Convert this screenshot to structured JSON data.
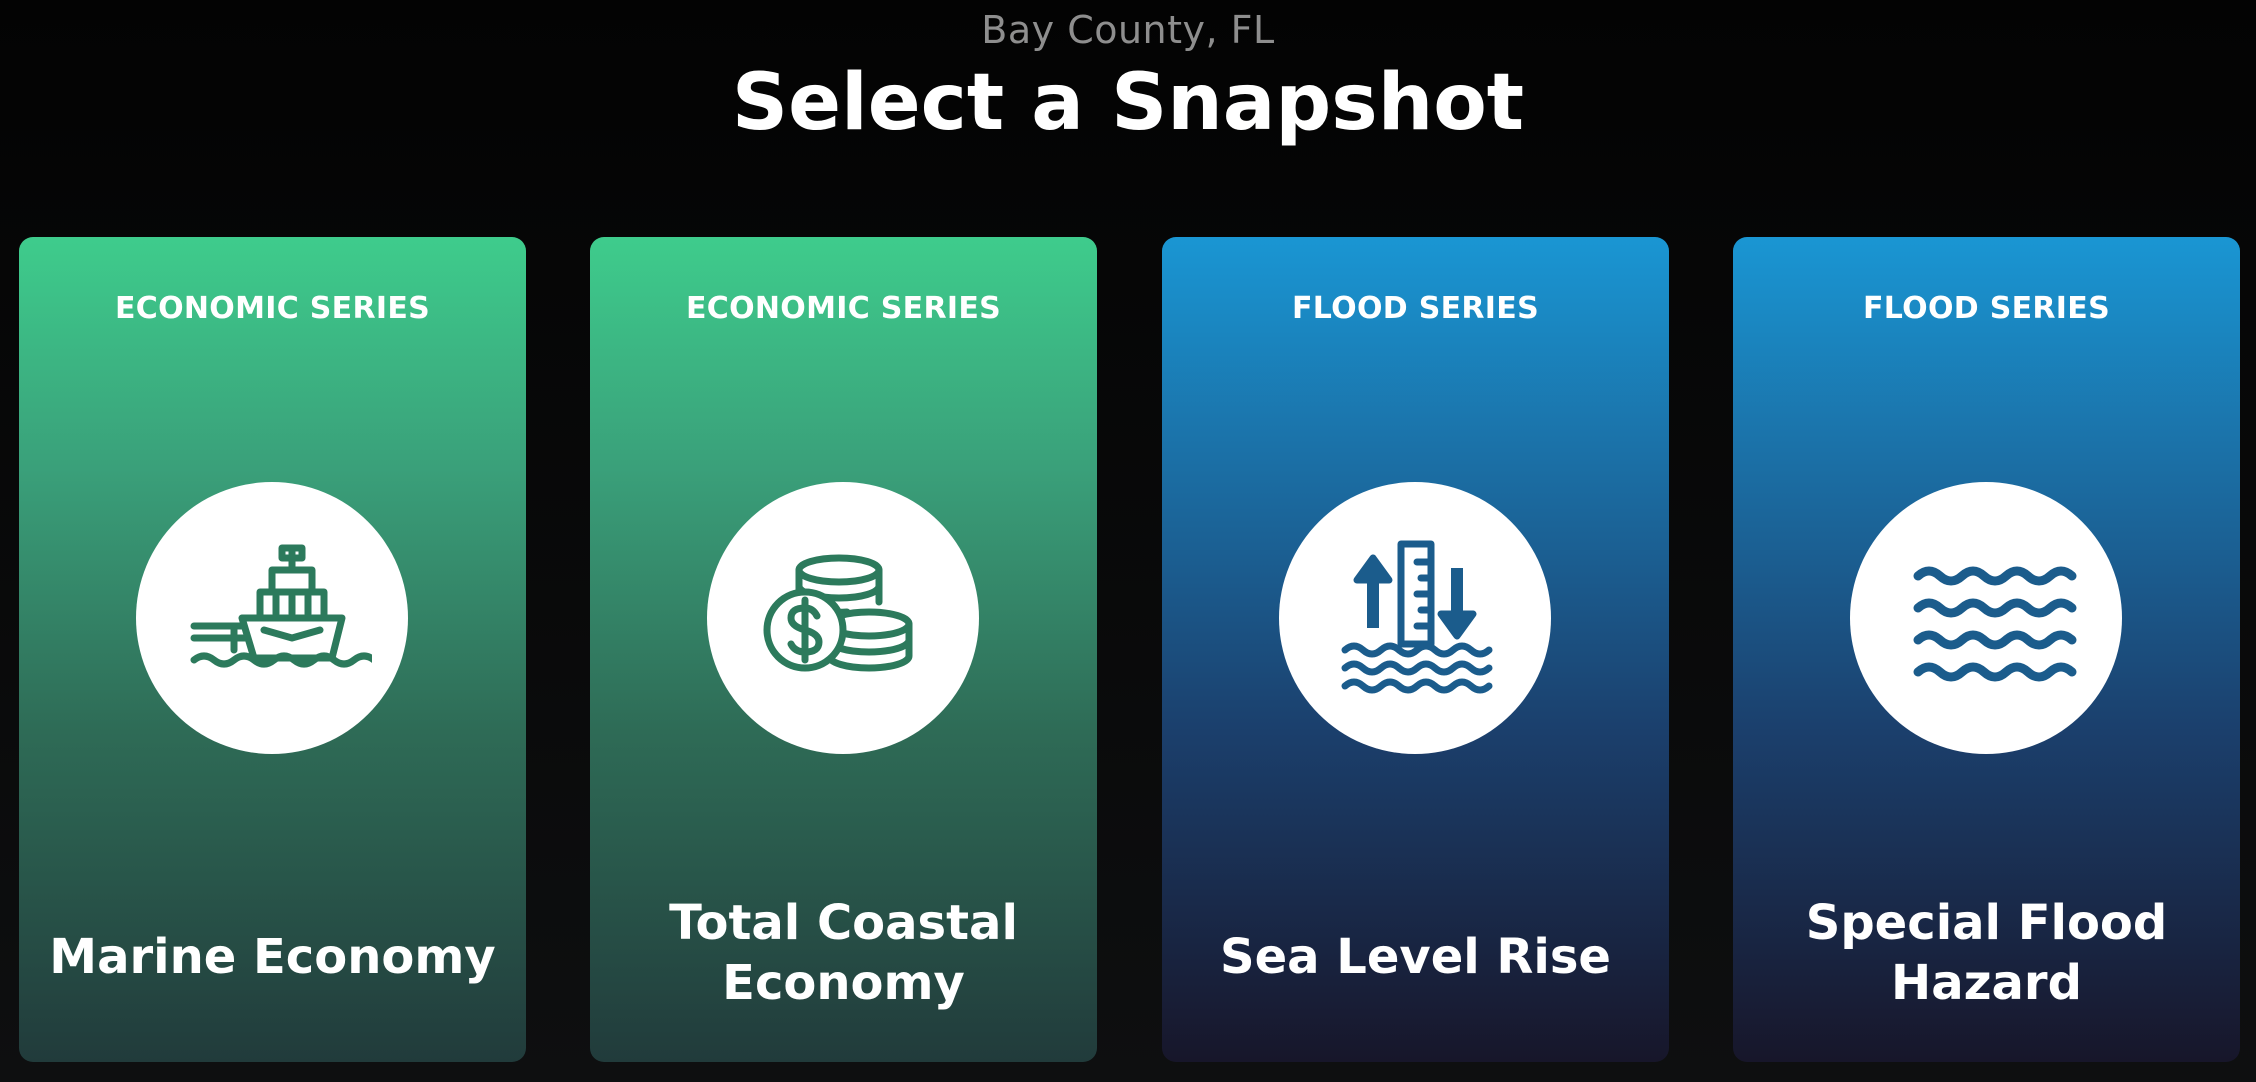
{
  "header": {
    "location": "Bay County, FL",
    "title": "Select a Snapshot"
  },
  "cards": [
    {
      "series": "ECONOMIC SERIES",
      "title_lines": [
        "Marine Economy"
      ],
      "icon": "ship-icon",
      "theme_color": "#3ecc8c"
    },
    {
      "series": "ECONOMIC SERIES",
      "title_lines": [
        "Total Coastal",
        "Economy"
      ],
      "icon": "coins-dollar-icon",
      "theme_color": "#3ecc8c"
    },
    {
      "series": "FLOOD SERIES",
      "title_lines": [
        "Sea Level Rise"
      ],
      "icon": "sea-level-gauge-icon",
      "theme_color": "#1a96d3"
    },
    {
      "series": "FLOOD SERIES",
      "title_lines": [
        "Special Flood",
        "Hazard"
      ],
      "icon": "waves-icon",
      "theme_color": "#1a96d3"
    }
  ],
  "colors": {
    "economic_icon": "#2c7a5c",
    "flood_icon": "#1b5c8c",
    "background": "#050505"
  }
}
